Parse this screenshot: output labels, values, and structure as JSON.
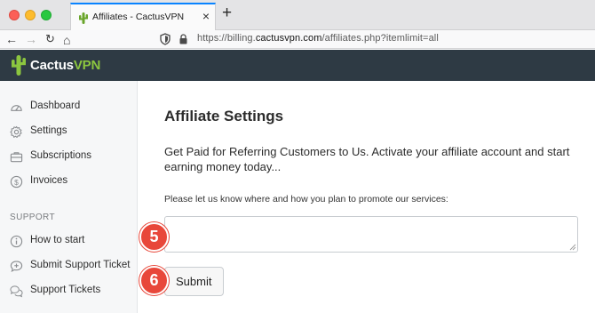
{
  "browser": {
    "tab_title": "Affiliates - CactusVPN",
    "tab_close": "×",
    "new_tab": "+",
    "url_prefix": "https://billing.",
    "url_host": "cactusvpn.com",
    "url_path": "/affiliates.php?itemlimit=all",
    "nav_back": "←",
    "nav_forward": "→",
    "nav_reload": "↻",
    "nav_home": "⌂"
  },
  "brand": {
    "name_main": "Cactus",
    "name_accent": "VPN",
    "accent_color": "#8cc63f",
    "header_color": "#2e3a44"
  },
  "sidebar": {
    "items": [
      {
        "label": "Dashboard",
        "icon": "dashboard-icon"
      },
      {
        "label": "Settings",
        "icon": "gear-icon"
      },
      {
        "label": "Subscriptions",
        "icon": "briefcase-icon"
      },
      {
        "label": "Invoices",
        "icon": "dollar-circle-icon"
      }
    ],
    "support_heading": "SUPPORT",
    "support_items": [
      {
        "label": "How to start",
        "icon": "info-icon"
      },
      {
        "label": "Submit Support Ticket",
        "icon": "chat-plus-icon"
      },
      {
        "label": "Support Tickets",
        "icon": "chat-bubbles-icon"
      }
    ]
  },
  "main": {
    "title": "Affiliate Settings",
    "intro": "Get Paid for Referring Customers to Us. Activate your affiliate account and start earning money today...",
    "prompt": "Please let us know where and how you plan to promote our services:",
    "textarea_value": "",
    "submit_label": "Submit"
  },
  "steps": {
    "step_5": "5",
    "step_6": "6",
    "marker_color": "#e8473a"
  }
}
